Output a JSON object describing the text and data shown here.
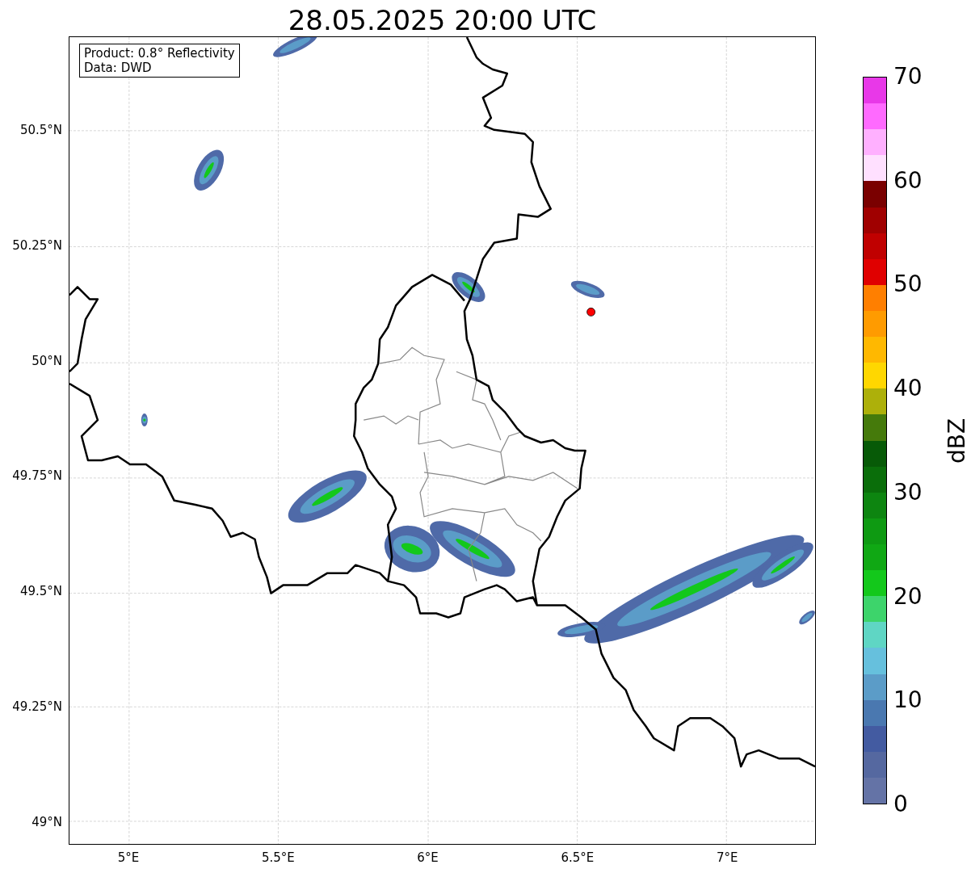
{
  "title": "28.05.2025 20:00 UTC",
  "info_box": {
    "lines": [
      "Product: 0.8° Reflectivity",
      "Data: DWD"
    ]
  },
  "map": {
    "lat_ticks": [
      "50.5°N",
      "50.25°N",
      "50°N",
      "49.75°N",
      "49.5°N",
      "49.25°N",
      "49°N"
    ],
    "lon_ticks": [
      "5°E",
      "5.5°E",
      "6°E",
      "6.5°E",
      "7°E"
    ]
  },
  "colorbar": {
    "label": "dBZ",
    "ticks": [
      "70",
      "60",
      "50",
      "40",
      "30",
      "20",
      "10",
      "0"
    ],
    "bands": [
      {
        "color": "#e838e8"
      },
      {
        "color": "#ff6aff"
      },
      {
        "color": "#ffb0ff"
      },
      {
        "color": "#ffe0ff"
      },
      {
        "color": "#7a0000"
      },
      {
        "color": "#a00000"
      },
      {
        "color": "#c00000"
      },
      {
        "color": "#e00000"
      },
      {
        "color": "#ff7f00"
      },
      {
        "color": "#ff9b00"
      },
      {
        "color": "#ffb800"
      },
      {
        "color": "#ffd700"
      },
      {
        "color": "#adb00a"
      },
      {
        "color": "#457a0b"
      },
      {
        "color": "#075a07"
      },
      {
        "color": "#0a6e0a"
      },
      {
        "color": "#0d8510"
      },
      {
        "color": "#0e9a12"
      },
      {
        "color": "#10a814"
      },
      {
        "color": "#13c81b"
      },
      {
        "color": "#3dd46b"
      },
      {
        "color": "#5fd6c4"
      },
      {
        "color": "#66c0dd"
      },
      {
        "color": "#5b9cc8"
      },
      {
        "color": "#4a78b0"
      },
      {
        "color": "#435ba1"
      },
      {
        "color": "#5568a0"
      },
      {
        "color": "#6473a6"
      }
    ]
  }
}
